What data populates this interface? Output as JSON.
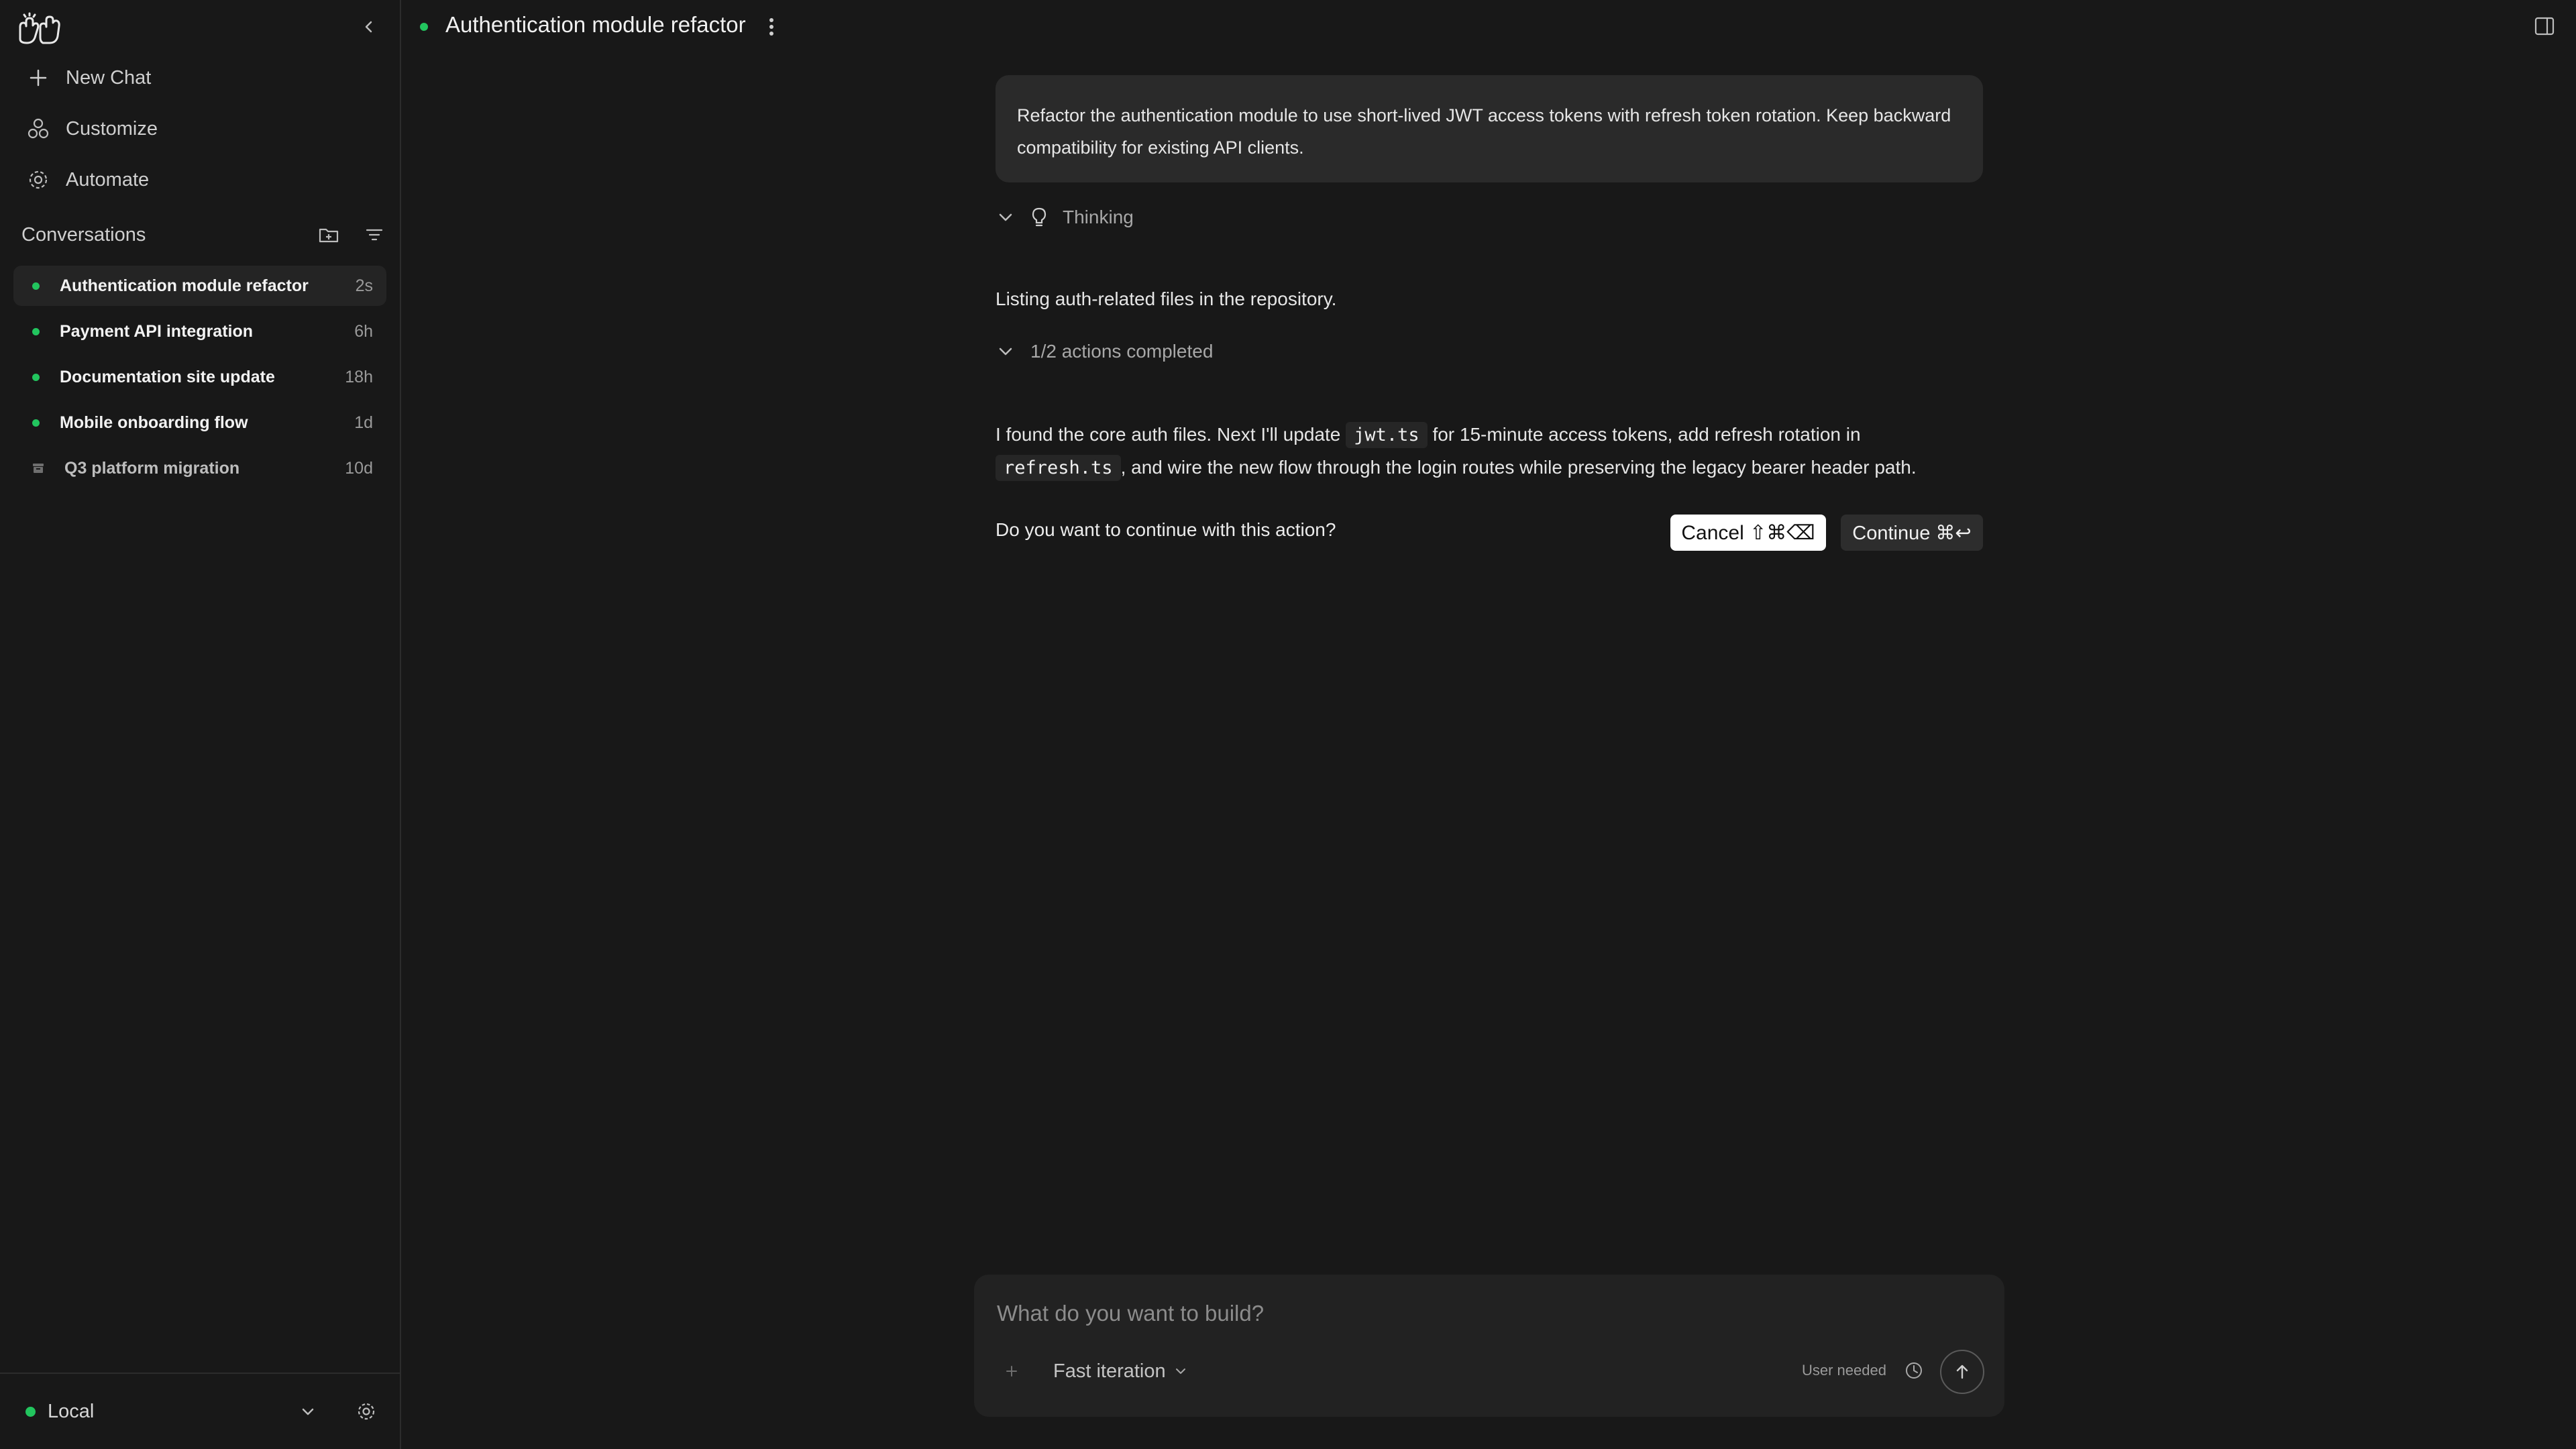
{
  "sidebar": {
    "nav": [
      {
        "label": "New Chat",
        "icon": "plus-icon"
      },
      {
        "label": "Customize",
        "icon": "customize-icon"
      },
      {
        "label": "Automate",
        "icon": "gear-icon"
      }
    ],
    "conversations_title": "Conversations",
    "conversations": [
      {
        "name": "Authentication module refactor",
        "time": "2s",
        "status": "active"
      },
      {
        "name": "Payment API integration",
        "time": "6h",
        "status": "active"
      },
      {
        "name": "Documentation site update",
        "time": "18h",
        "status": "active"
      },
      {
        "name": "Mobile onboarding flow",
        "time": "1d",
        "status": "active"
      },
      {
        "name": "Q3 platform migration",
        "time": "10d",
        "status": "archived"
      }
    ],
    "footer": {
      "environment": "Local"
    }
  },
  "header": {
    "title": "Authentication module refactor"
  },
  "chat": {
    "user_message": "Refactor the authentication module to use short-lived JWT access tokens with refresh token rotation. Keep backward compatibility for existing API clients.",
    "thinking_label": "Thinking",
    "status_message": "Listing auth-related files in the repository.",
    "actions_label": "1/2 actions completed",
    "reply": {
      "part1": "I found the core auth files. Next I'll update",
      "code1": "jwt.ts",
      "part2": "for 15-minute access tokens, add refresh rotation in",
      "code2": "refresh.ts",
      "part3": ", and wire the new flow through the login routes while preserving the legacy bearer header path."
    },
    "confirm_question": "Do you want to continue with this action?",
    "cancel_label": "Cancel ⇧⌘⌫",
    "continue_label": "Continue ⌘↩"
  },
  "composer": {
    "placeholder": "What do you want to build?",
    "mode": "Fast iteration",
    "status": "User needed"
  },
  "colors": {
    "background": "#181818",
    "accent_green": "#22c55e",
    "bubble": "#2a2a2a"
  }
}
